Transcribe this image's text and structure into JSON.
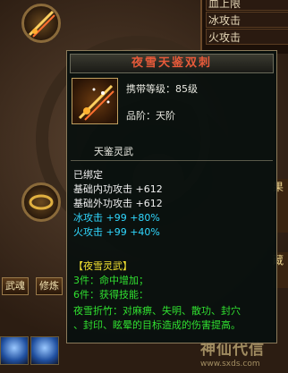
{
  "stat_panel": {
    "rows": [
      "血上限",
      "冰攻击",
      "火攻击"
    ]
  },
  "side_labels": {
    "right_top": "果",
    "right_bottom": "蔵"
  },
  "bottom_buttons": [
    "武魂",
    "修炼"
  ],
  "watermark": {
    "text": "神仙代信",
    "url": "www.sxds.com"
  },
  "tooltip": {
    "title": "夜雪天鉴双刺",
    "level_label": "携带等级：85级",
    "grade_label": "品阶：天阶",
    "subtitle": "天鉴灵武",
    "bound": "已绑定",
    "stats": [
      {
        "label": "基础内功攻击",
        "value": "+612"
      },
      {
        "label": "基础外功攻击",
        "value": "+612"
      },
      {
        "label": "冰攻击",
        "value": "+99",
        "bonus": "+80%"
      },
      {
        "label": "火攻击",
        "value": "+99",
        "bonus": "+40%"
      }
    ],
    "set_name": "【夜雪灵武】",
    "set_bonuses": [
      "3件：命中增加；",
      "6件：获得技能："
    ],
    "skill_desc_1": "夜雪折竹：对麻痹、失明、散功、封穴",
    "skill_desc_2": "、封印、眩晕的目标造成的伤害提高。"
  },
  "colors": {
    "title": "#e65a3a",
    "element_stat": "#30d8ff",
    "set_text": "#30e030",
    "set_name": "#f0e030"
  },
  "icons": {
    "item": "twin-daggers-icon",
    "slot": "weapon-slot-icon"
  }
}
